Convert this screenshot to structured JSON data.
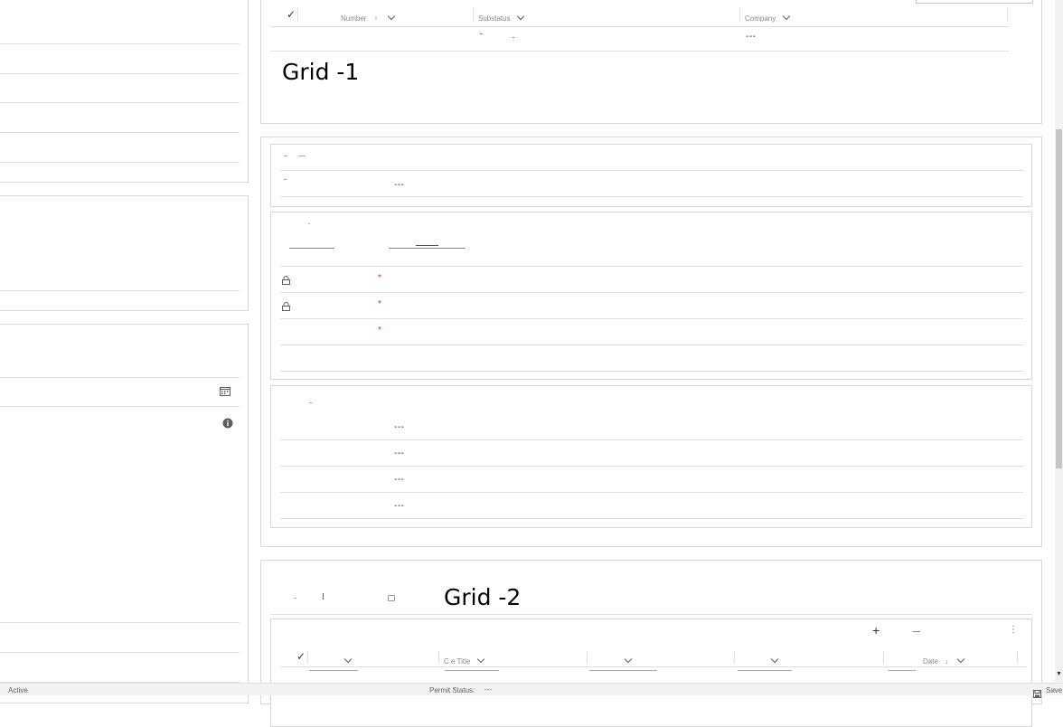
{
  "grid1": {
    "columns": [
      "Number",
      "Substatus",
      "Company"
    ],
    "sort_arrow": "↑",
    "row": {
      "company": "---"
    },
    "label": "Grid -1"
  },
  "section_a": {
    "rows": [
      {
        "value": ""
      },
      {
        "value": "---"
      }
    ]
  },
  "section_c": {
    "rows": [
      {
        "value": "---"
      },
      {
        "value": "---"
      },
      {
        "value": "---"
      },
      {
        "value": "---"
      }
    ]
  },
  "grid2": {
    "label": "Grid -2",
    "columns": [
      "C  e Title",
      "Date"
    ],
    "add_icon": "+",
    "more_icon": "⋮",
    "sort_arrow": "↓"
  },
  "status_bar": {
    "status": "Active",
    "permit_label": "Permit Status:",
    "permit_value": "---",
    "save_label": "Save"
  },
  "icons": [
    "checkmark-icon",
    "chevron-down-icon",
    "lock-icon",
    "calendar-icon",
    "info-icon",
    "plus-icon",
    "more-icon",
    "save-icon"
  ]
}
